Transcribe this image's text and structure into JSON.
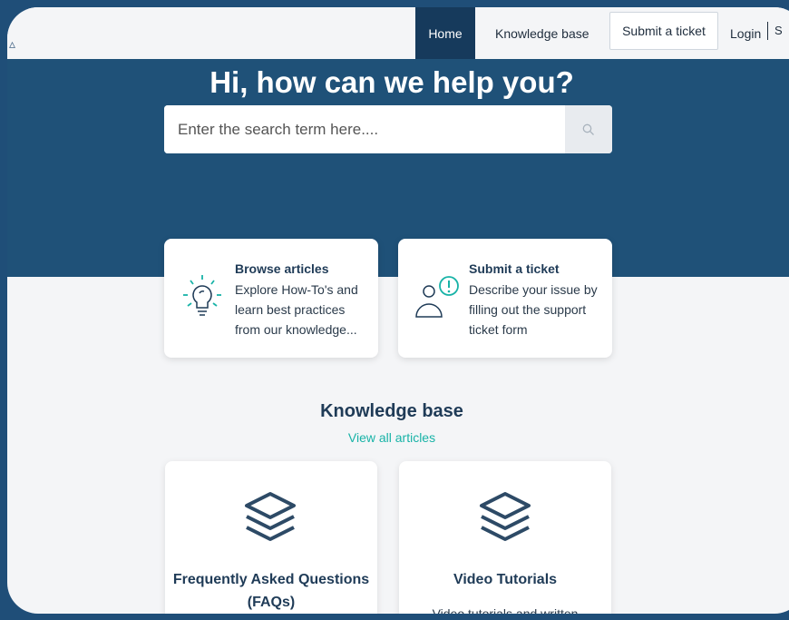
{
  "nav": {
    "home": "Home",
    "knowledge_base": "Knowledge base",
    "submit_ticket": "Submit a ticket",
    "login": "Login",
    "more": "S"
  },
  "hero": {
    "title": "Hi, how can we help you?",
    "search_placeholder": "Enter the search term here...."
  },
  "cards": [
    {
      "title": "Browse articles",
      "desc": "Explore How-To's and learn best practices from our knowledge..."
    },
    {
      "title": "Submit a ticket",
      "desc": "Describe your issue by filling out the support ticket form"
    }
  ],
  "knowledge_base": {
    "heading": "Knowledge base",
    "link": "View all articles",
    "categories": [
      {
        "title": "Frequently Asked Questions (FAQs)",
        "desc": ""
      },
      {
        "title": "Video Tutorials",
        "desc": "Video tutorials and written"
      }
    ]
  },
  "colors": {
    "brand": "#1f5178",
    "accent": "#18b3a7",
    "active_nav": "#163a5c"
  }
}
